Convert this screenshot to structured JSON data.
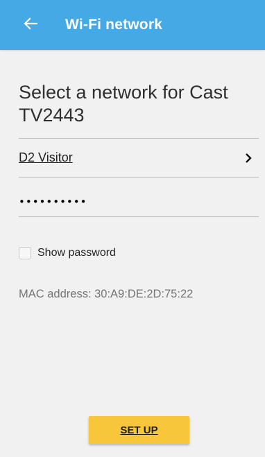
{
  "appbar": {
    "title": "Wi-Fi network",
    "back_icon": "arrow-left-icon",
    "background": "#45a9e5"
  },
  "main": {
    "heading": "Select a network for Cast TV2443",
    "network": {
      "name": "D2 Visitor",
      "icon": "chevron-right-icon"
    },
    "password": {
      "value": "••••••••••"
    },
    "show_password": {
      "label": "Show password",
      "checked": false
    },
    "mac_address": "MAC address: 30:A9:DE:2D:75:22"
  },
  "footer": {
    "setup_label": "SET UP",
    "setup_color": "#f8c63a"
  }
}
